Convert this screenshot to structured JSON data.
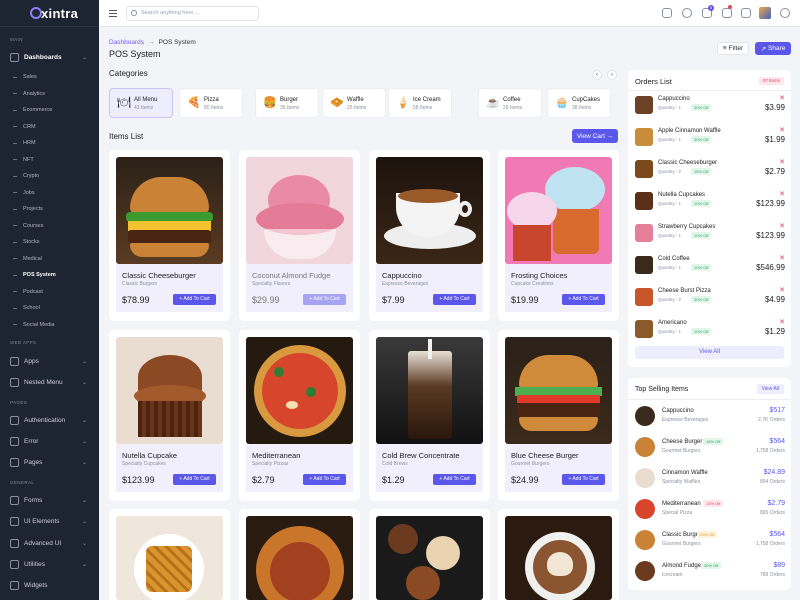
{
  "brand": {
    "name": "xintra"
  },
  "sidebar": {
    "sections": {
      "main": "MAIN",
      "web_apps": "WEB APPS",
      "pages": "PAGES",
      "general": "GENERAL"
    },
    "dashboards": "Dashboards",
    "sub_items": [
      "Sales",
      "Analytics",
      "Ecommerce",
      "CRM",
      "HRM",
      "NFT",
      "Crypto",
      "Jobs",
      "Projects",
      "Courses",
      "Stocks",
      "Medical",
      "POS System",
      "Podcast",
      "School",
      "Social Media"
    ],
    "apps": "Apps",
    "nested_menu": "Nested Menu",
    "authentication": "Authentication",
    "error": "Error",
    "pages": "Pages",
    "forms": "Forms",
    "ui_elements": "UI Elements",
    "advanced_ui": "Advanced UI",
    "utilities": "Utilities",
    "widgets": "Widgets"
  },
  "topbar": {
    "search_placeholder": "Search anything here ...",
    "cart_badge": "5",
    "notif_badge": "1"
  },
  "breadcrumb": {
    "parent": "Dashboards",
    "sep": "→",
    "current": "POS System"
  },
  "page_title": "POS System",
  "actions": {
    "filter": "Filter",
    "share": "Share"
  },
  "categories_title": "Categories",
  "categories": [
    {
      "name": "All Menu",
      "count": "43 Items",
      "icon": "🍽"
    },
    {
      "name": "Pizza",
      "count": "80 Items",
      "icon": "🍕"
    },
    {
      "name": "Burger",
      "count": "35 Items",
      "icon": "🍔"
    },
    {
      "name": "Waffle",
      "count": "25 Items",
      "icon": "🧇"
    },
    {
      "name": "Ice Cream",
      "count": "58 Items",
      "icon": "🍦"
    },
    {
      "name": "Coffee",
      "count": "29 Items",
      "icon": "☕"
    },
    {
      "name": "CupCakes",
      "count": "38 Items",
      "icon": "🧁"
    }
  ],
  "items_title": "Items List",
  "view_cart": "View Cart →",
  "add_to_cart": "+ Add To Cart",
  "items": [
    {
      "name": "Classic Cheeseburger",
      "sub": "Classic Burgers",
      "price": "$78.99"
    },
    {
      "name": "Coconut Almond Fudge",
      "sub": "Specialty Flavors",
      "price": "$29.99"
    },
    {
      "name": "Cappuccino",
      "sub": "Espresso Beverages",
      "price": "$7.99"
    },
    {
      "name": "Frosting Choices",
      "sub": "Cupcake Creations",
      "price": "$19.99"
    },
    {
      "name": "Nutella Cupcake",
      "sub": "Specialty Cupcakes",
      "price": "$123.99"
    },
    {
      "name": "Mediterranean",
      "sub": "Specialty Pizzas",
      "price": "$2.79"
    },
    {
      "name": "Cold Brew Concentrate",
      "sub": "Cold Brews",
      "price": "$1.29"
    },
    {
      "name": "Blue Cheese Burger",
      "sub": "Gourmet Burgers",
      "price": "$24.99"
    }
  ],
  "orders": {
    "title": "Orders List",
    "badge": "07 Items",
    "view_all": "View All",
    "rows": [
      {
        "name": "Cappuccino",
        "qty": "Quantity : 1",
        "off": "30% Off",
        "price": "$3.99"
      },
      {
        "name": "Apple Cinnamon Waffle",
        "qty": "Quantity : 1",
        "off": "30% Off",
        "price": "$1.99"
      },
      {
        "name": "Classic Cheeseburger",
        "qty": "Quantity : 2",
        "off": "15% Off",
        "price": "$2.79"
      },
      {
        "name": "Nutella Cupcakes",
        "qty": "Quantity : 1",
        "off": "10% Off",
        "price": "$123.99"
      },
      {
        "name": "Strawberry Cupcakes",
        "qty": "Quantity : 1",
        "off": "10% Off",
        "price": "$123.99"
      },
      {
        "name": "Cold Coffee",
        "qty": "Quantity : 1",
        "off": "10% Off",
        "price": "$546.99"
      },
      {
        "name": "Cheese Burst Pizza",
        "qty": "Quantity : 2",
        "off": "30% Off",
        "price": "$4.99"
      },
      {
        "name": "Americano",
        "qty": "Quantity : 1",
        "off": "10% Off",
        "price": "$1.29"
      }
    ]
  },
  "top_selling": {
    "title": "Top Selling Items",
    "btn": "View All",
    "rows": [
      {
        "name": "Cappuccino",
        "sub": "Espresso Beverages",
        "price": "$517",
        "count": "2.7K Orders",
        "disc": ""
      },
      {
        "name": "Cheese Burger",
        "sub": "Gourmet Burgers",
        "price": "$564",
        "count": "1,758 Orders",
        "disc": "15% Off"
      },
      {
        "name": "Cinnamon Waffle",
        "sub": "Specialty Waffles",
        "price": "$24.89",
        "count": "894 Orders",
        "disc": ""
      },
      {
        "name": "Mediterranean",
        "sub": "Special Pizza",
        "price": "$2.79",
        "count": "865 Orders",
        "disc": "10% Off"
      },
      {
        "name": "Classic Burger",
        "sub": "Gourmet Burgers",
        "price": "$564",
        "count": "1,758 Orders",
        "disc": "20% Off"
      },
      {
        "name": "Almond Fudge",
        "sub": "Icecream",
        "price": "$89",
        "count": "789 Orders",
        "disc": "30% Off"
      }
    ]
  },
  "colors": {
    "accent": "#5b57ea",
    "sidebar": "#1e2532",
    "danger": "#e8455f",
    "success": "#2ba560"
  }
}
